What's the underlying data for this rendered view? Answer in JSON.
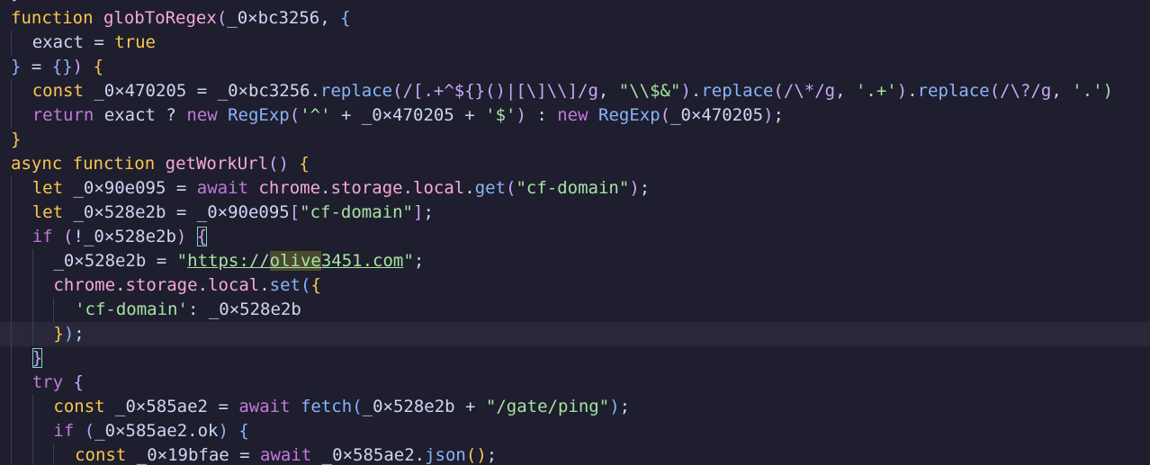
{
  "theme": {
    "background": "#1e1e2e",
    "current_line": "#282839",
    "bracket_match_outline": "#7fd4c4",
    "find_highlight": "#4b4a2e"
  },
  "colors": {
    "kw": "#c678dd",
    "storage": "#f9c74f",
    "fn": "#f7a8d8",
    "var": "#cdd6f4",
    "method": "#89b4fa",
    "str": "#a6e3a1",
    "regex": "#cba6f7",
    "regex_esc": "#f5c2e7",
    "punct": "#cdd6f4",
    "brace1": "#f9c74f",
    "brace2": "#cba6f7",
    "brace3": "#89b4fa",
    "const_kw": "#f9c74f",
    "bool": "#f9c74f",
    "op": "#cdd6f4"
  },
  "editor": {
    "top_clip": "}",
    "lines": [
      {
        "indent": 0,
        "tokens": [
          {
            "t": "function",
            "c": "storage"
          },
          {
            "t": " "
          },
          {
            "t": "globToRegex",
            "c": "fn"
          },
          {
            "t": "(",
            "c": "brace2"
          },
          {
            "t": "_0×bc3256",
            "c": "var"
          },
          {
            "t": ", ",
            "c": "punct"
          },
          {
            "t": "{",
            "c": "brace3"
          }
        ]
      },
      {
        "indent": 1,
        "tokens": [
          {
            "t": "exact",
            "c": "var"
          },
          {
            "t": " = ",
            "c": "op"
          },
          {
            "t": "true",
            "c": "bool"
          }
        ]
      },
      {
        "indent": 0,
        "tokens": [
          {
            "t": "}",
            "c": "brace3"
          },
          {
            "t": " = ",
            "c": "op"
          },
          {
            "t": "{}",
            "c": "brace3"
          },
          {
            "t": ")",
            "c": "brace2"
          },
          {
            "t": " "
          },
          {
            "t": "{",
            "c": "brace1"
          }
        ]
      },
      {
        "indent": 1,
        "tokens": [
          {
            "t": "const",
            "c": "const_kw"
          },
          {
            "t": " "
          },
          {
            "t": "_0×470205",
            "c": "var"
          },
          {
            "t": " = ",
            "c": "op"
          },
          {
            "t": "_0×bc3256",
            "c": "var"
          },
          {
            "t": ".",
            "c": "punct"
          },
          {
            "t": "replace",
            "c": "method"
          },
          {
            "t": "(",
            "c": "brace2"
          },
          {
            "t": "/[.+^${}()|[\\]\\\\]/g",
            "c": "regex"
          },
          {
            "t": ", ",
            "c": "punct"
          },
          {
            "t": "\"\\\\$&\"",
            "c": "str"
          },
          {
            "t": ")",
            "c": "brace2"
          },
          {
            "t": ".",
            "c": "punct"
          },
          {
            "t": "replace",
            "c": "method"
          },
          {
            "t": "(",
            "c": "brace2"
          },
          {
            "t": "/\\*/g",
            "c": "regex"
          },
          {
            "t": ", ",
            "c": "punct"
          },
          {
            "t": "'.+'",
            "c": "str"
          },
          {
            "t": ")",
            "c": "brace2"
          },
          {
            "t": ".",
            "c": "punct"
          },
          {
            "t": "replace",
            "c": "method"
          },
          {
            "t": "(",
            "c": "brace2"
          },
          {
            "t": "/\\?/g",
            "c": "regex"
          },
          {
            "t": ", ",
            "c": "punct"
          },
          {
            "t": "'.')",
            "c": "str"
          }
        ]
      },
      {
        "indent": 1,
        "tokens": [
          {
            "t": "return",
            "c": "kw"
          },
          {
            "t": " "
          },
          {
            "t": "exact",
            "c": "var"
          },
          {
            "t": " ? ",
            "c": "op"
          },
          {
            "t": "new",
            "c": "kw"
          },
          {
            "t": " "
          },
          {
            "t": "RegExp",
            "c": "method"
          },
          {
            "t": "(",
            "c": "brace2"
          },
          {
            "t": "'^'",
            "c": "str"
          },
          {
            "t": " + ",
            "c": "op"
          },
          {
            "t": "_0×470205",
            "c": "var"
          },
          {
            "t": " + ",
            "c": "op"
          },
          {
            "t": "'$'",
            "c": "str"
          },
          {
            "t": ")",
            "c": "brace2"
          },
          {
            "t": " : ",
            "c": "op"
          },
          {
            "t": "new",
            "c": "kw"
          },
          {
            "t": " "
          },
          {
            "t": "RegExp",
            "c": "method"
          },
          {
            "t": "(",
            "c": "brace2"
          },
          {
            "t": "_0×470205",
            "c": "var"
          },
          {
            "t": ")",
            "c": "brace2"
          },
          {
            "t": ";",
            "c": "punct"
          }
        ]
      },
      {
        "indent": 0,
        "tokens": [
          {
            "t": "}",
            "c": "brace1"
          }
        ]
      },
      {
        "indent": 0,
        "tokens": [
          {
            "t": "async",
            "c": "storage"
          },
          {
            "t": " "
          },
          {
            "t": "function",
            "c": "storage"
          },
          {
            "t": " "
          },
          {
            "t": "getWorkUrl",
            "c": "fn"
          },
          {
            "t": "()",
            "c": "brace2"
          },
          {
            "t": " "
          },
          {
            "t": "{",
            "c": "brace1"
          }
        ]
      },
      {
        "indent": 1,
        "tokens": [
          {
            "t": "let",
            "c": "const_kw"
          },
          {
            "t": " "
          },
          {
            "t": "_0×90e095",
            "c": "var"
          },
          {
            "t": " = ",
            "c": "op"
          },
          {
            "t": "await",
            "c": "kw"
          },
          {
            "t": " "
          },
          {
            "t": "chrome",
            "c": "fn"
          },
          {
            "t": ".",
            "c": "punct"
          },
          {
            "t": "storage",
            "c": "fn"
          },
          {
            "t": ".",
            "c": "punct"
          },
          {
            "t": "local",
            "c": "fn"
          },
          {
            "t": ".",
            "c": "punct"
          },
          {
            "t": "get",
            "c": "method"
          },
          {
            "t": "(",
            "c": "brace2"
          },
          {
            "t": "\"cf-domain\"",
            "c": "str"
          },
          {
            "t": ")",
            "c": "brace2"
          },
          {
            "t": ";",
            "c": "punct"
          }
        ]
      },
      {
        "indent": 1,
        "tokens": [
          {
            "t": "let",
            "c": "const_kw"
          },
          {
            "t": " "
          },
          {
            "t": "_0×528e2b",
            "c": "var"
          },
          {
            "t": " = ",
            "c": "op"
          },
          {
            "t": "_0×90e095",
            "c": "var"
          },
          {
            "t": "[",
            "c": "brace2"
          },
          {
            "t": "\"cf-domain\"",
            "c": "str"
          },
          {
            "t": "]",
            "c": "brace2"
          },
          {
            "t": ";",
            "c": "punct"
          }
        ]
      },
      {
        "indent": 1,
        "tokens": [
          {
            "t": "if",
            "c": "kw"
          },
          {
            "t": " "
          },
          {
            "t": "(",
            "c": "brace2"
          },
          {
            "t": "!",
            "c": "op"
          },
          {
            "t": "_0×528e2b",
            "c": "var"
          },
          {
            "t": ")",
            "c": "brace2"
          },
          {
            "t": " "
          },
          {
            "t": "{",
            "c": "brace2",
            "bm": true
          }
        ]
      },
      {
        "indent": 2,
        "tokens": [
          {
            "t": "_0×528e2b",
            "c": "var"
          },
          {
            "t": " = ",
            "c": "op"
          },
          {
            "t": "\"",
            "c": "str"
          },
          {
            "t": "https://",
            "c": "str",
            "link": true
          },
          {
            "t": "olive",
            "c": "str",
            "link": true,
            "hl": true
          },
          {
            "t": "3451.com",
            "c": "str",
            "link": true
          },
          {
            "t": "\"",
            "c": "str"
          },
          {
            "t": ";",
            "c": "punct"
          }
        ]
      },
      {
        "indent": 2,
        "tokens": [
          {
            "t": "chrome",
            "c": "fn"
          },
          {
            "t": ".",
            "c": "punct"
          },
          {
            "t": "storage",
            "c": "fn"
          },
          {
            "t": ".",
            "c": "punct"
          },
          {
            "t": "local",
            "c": "fn"
          },
          {
            "t": ".",
            "c": "punct"
          },
          {
            "t": "set",
            "c": "method"
          },
          {
            "t": "(",
            "c": "brace3"
          },
          {
            "t": "{",
            "c": "brace1"
          }
        ]
      },
      {
        "indent": 3,
        "tokens": [
          {
            "t": "'cf-domain'",
            "c": "str"
          },
          {
            "t": ": ",
            "c": "punct"
          },
          {
            "t": "_0×528e2b",
            "c": "var"
          }
        ]
      },
      {
        "indent": 2,
        "current": true,
        "tokens": [
          {
            "t": "}",
            "c": "brace1"
          },
          {
            "t": ")",
            "c": "brace3"
          },
          {
            "t": ";",
            "c": "punct"
          }
        ]
      },
      {
        "indent": 1,
        "tokens": [
          {
            "t": "}",
            "c": "brace2",
            "bm": true
          }
        ]
      },
      {
        "indent": 1,
        "tokens": [
          {
            "t": "try",
            "c": "kw"
          },
          {
            "t": " "
          },
          {
            "t": "{",
            "c": "brace2"
          }
        ]
      },
      {
        "indent": 2,
        "tokens": [
          {
            "t": "const",
            "c": "const_kw"
          },
          {
            "t": " "
          },
          {
            "t": "_0×585ae2",
            "c": "var"
          },
          {
            "t": " = ",
            "c": "op"
          },
          {
            "t": "await",
            "c": "kw"
          },
          {
            "t": " "
          },
          {
            "t": "fetch",
            "c": "method"
          },
          {
            "t": "(",
            "c": "brace3"
          },
          {
            "t": "_0×528e2b",
            "c": "var"
          },
          {
            "t": " + ",
            "c": "op"
          },
          {
            "t": "\"/gate/ping\"",
            "c": "str"
          },
          {
            "t": ")",
            "c": "brace3"
          },
          {
            "t": ";",
            "c": "punct"
          }
        ]
      },
      {
        "indent": 2,
        "tokens": [
          {
            "t": "if",
            "c": "kw"
          },
          {
            "t": " "
          },
          {
            "t": "(",
            "c": "brace3"
          },
          {
            "t": "_0×585ae2",
            "c": "var"
          },
          {
            "t": ".",
            "c": "punct"
          },
          {
            "t": "ok",
            "c": "var"
          },
          {
            "t": ")",
            "c": "brace3"
          },
          {
            "t": " "
          },
          {
            "t": "{",
            "c": "brace3"
          }
        ]
      },
      {
        "indent": 3,
        "tokens": [
          {
            "t": "const",
            "c": "const_kw"
          },
          {
            "t": " "
          },
          {
            "t": "_0×19bfae",
            "c": "var"
          },
          {
            "t": " = ",
            "c": "op"
          },
          {
            "t": "await",
            "c": "kw"
          },
          {
            "t": " "
          },
          {
            "t": "_0×585ae2",
            "c": "var"
          },
          {
            "t": ".",
            "c": "punct"
          },
          {
            "t": "json",
            "c": "method"
          },
          {
            "t": "(",
            "c": "brace1"
          },
          {
            "t": ")",
            "c": "brace1"
          },
          {
            "t": ";",
            "c": "punct"
          }
        ]
      }
    ]
  }
}
